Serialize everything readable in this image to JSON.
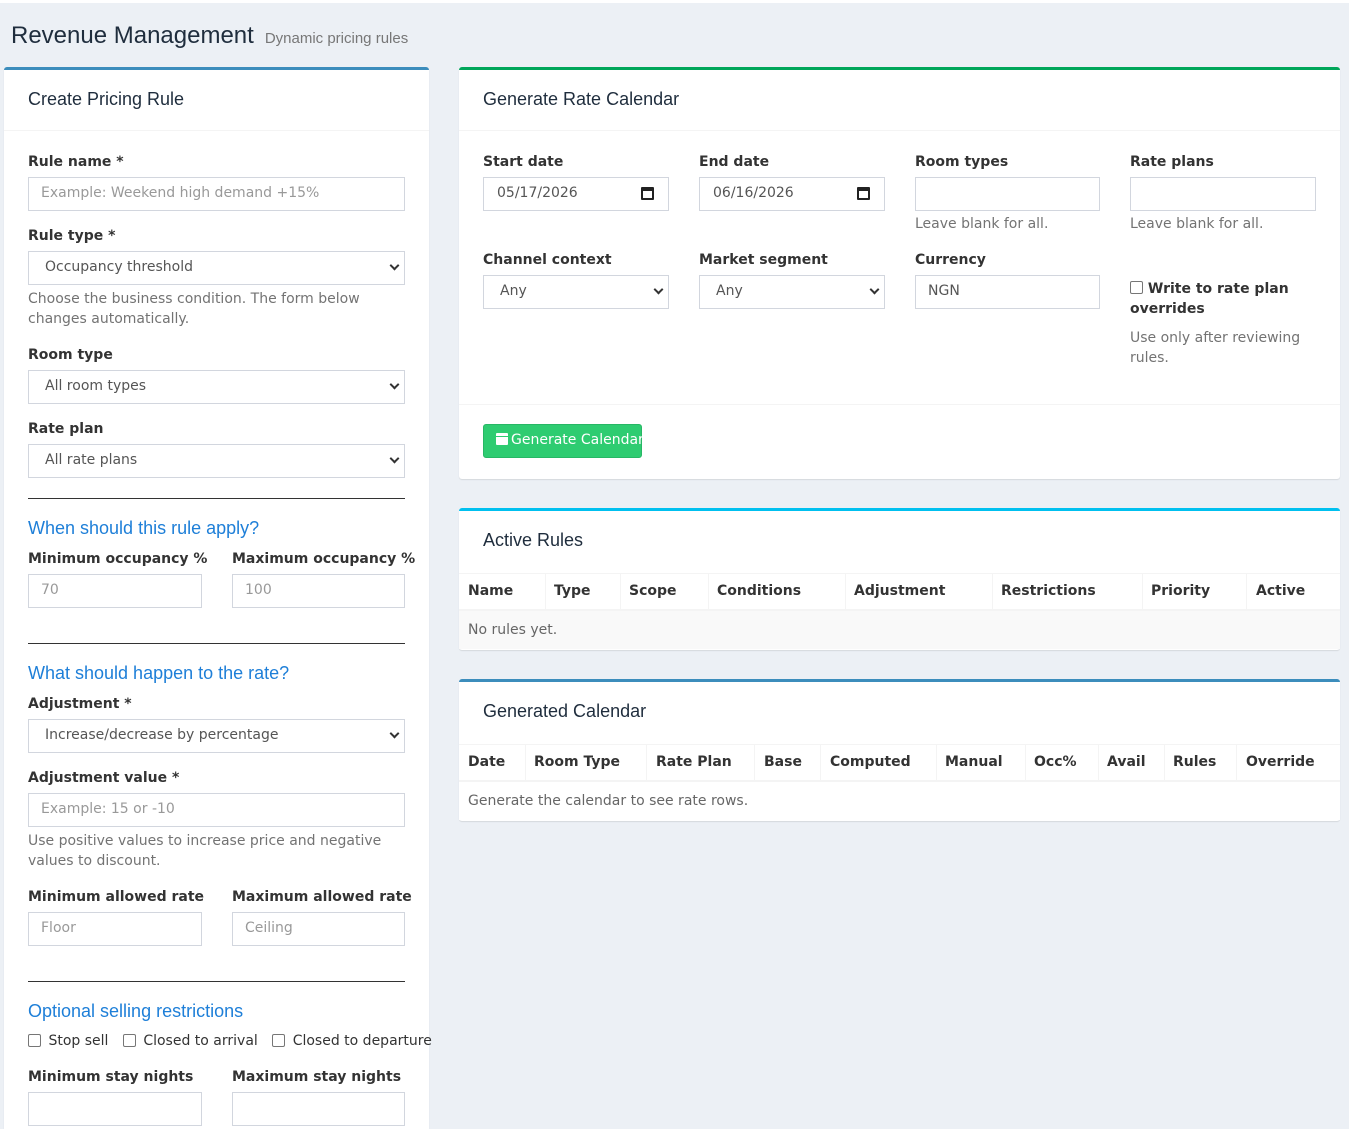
{
  "header": {
    "title": "Revenue Management",
    "subtitle": "Dynamic pricing rules"
  },
  "create_rule": {
    "title": "Create Pricing Rule",
    "rule_name": {
      "label": "Rule name *",
      "placeholder": "Example: Weekend high demand +15%"
    },
    "rule_type": {
      "label": "Rule type *",
      "value": "Occupancy threshold",
      "help": "Choose the business condition. The form below changes automatically."
    },
    "room_type": {
      "label": "Room type",
      "value": "All room types"
    },
    "rate_plan": {
      "label": "Rate plan",
      "value": "All rate plans"
    },
    "apply_heading": "When should this rule apply?",
    "min_occupancy": {
      "label": "Minimum occupancy %",
      "placeholder": "70"
    },
    "max_occupancy": {
      "label": "Maximum occupancy %",
      "placeholder": "100"
    },
    "rate_heading": "What should happen to the rate?",
    "adjustment": {
      "label": "Adjustment *",
      "value": "Increase/decrease by percentage"
    },
    "adjustment_value": {
      "label": "Adjustment value *",
      "placeholder": "Example: 15 or -10",
      "help": "Use positive values to increase price and negative values to discount."
    },
    "min_rate": {
      "label": "Minimum allowed rate",
      "placeholder": "Floor"
    },
    "max_rate": {
      "label": "Maximum allowed rate",
      "placeholder": "Ceiling"
    },
    "restrictions_heading": "Optional selling restrictions",
    "restrictions": {
      "stop_sell": "Stop sell",
      "closed_arrival": "Closed to arrival",
      "closed_departure": "Closed to departure"
    },
    "min_stay": {
      "label": "Minimum stay nights"
    },
    "max_stay": {
      "label": "Maximum stay nights"
    }
  },
  "rate_calendar": {
    "title": "Generate Rate Calendar",
    "start_date": {
      "label": "Start date",
      "value": "05/17/2026"
    },
    "end_date": {
      "label": "End date",
      "value": "06/16/2026"
    },
    "room_types": {
      "label": "Room types",
      "help": "Leave blank for all."
    },
    "rate_plans": {
      "label": "Rate plans",
      "help": "Leave blank for all."
    },
    "channel_context": {
      "label": "Channel context",
      "value": "Any"
    },
    "market_segment": {
      "label": "Market segment",
      "value": "Any"
    },
    "currency": {
      "label": "Currency",
      "value": "NGN"
    },
    "write_overrides": {
      "label": "Write to rate plan overrides",
      "help": "Use only after reviewing rules."
    },
    "generate_button": "Generate Calendar"
  },
  "active_rules": {
    "title": "Active Rules",
    "columns": [
      "Name",
      "Type",
      "Scope",
      "Conditions",
      "Adjustment",
      "Restrictions",
      "Priority",
      "Active"
    ],
    "empty": "No rules yet."
  },
  "generated_calendar": {
    "title": "Generated Calendar",
    "columns": [
      "Date",
      "Room Type",
      "Rate Plan",
      "Base",
      "Computed",
      "Manual",
      "Occ%",
      "Avail",
      "Rules",
      "Override"
    ],
    "empty": "Generate the calendar to see rate rows."
  },
  "colors": {
    "accent_blue": "#3c8dbc",
    "accent_green": "#00a65a",
    "accent_cyan": "#00c0ef",
    "button_green": "#2ecc71",
    "section_heading": "#1e7fd8"
  }
}
